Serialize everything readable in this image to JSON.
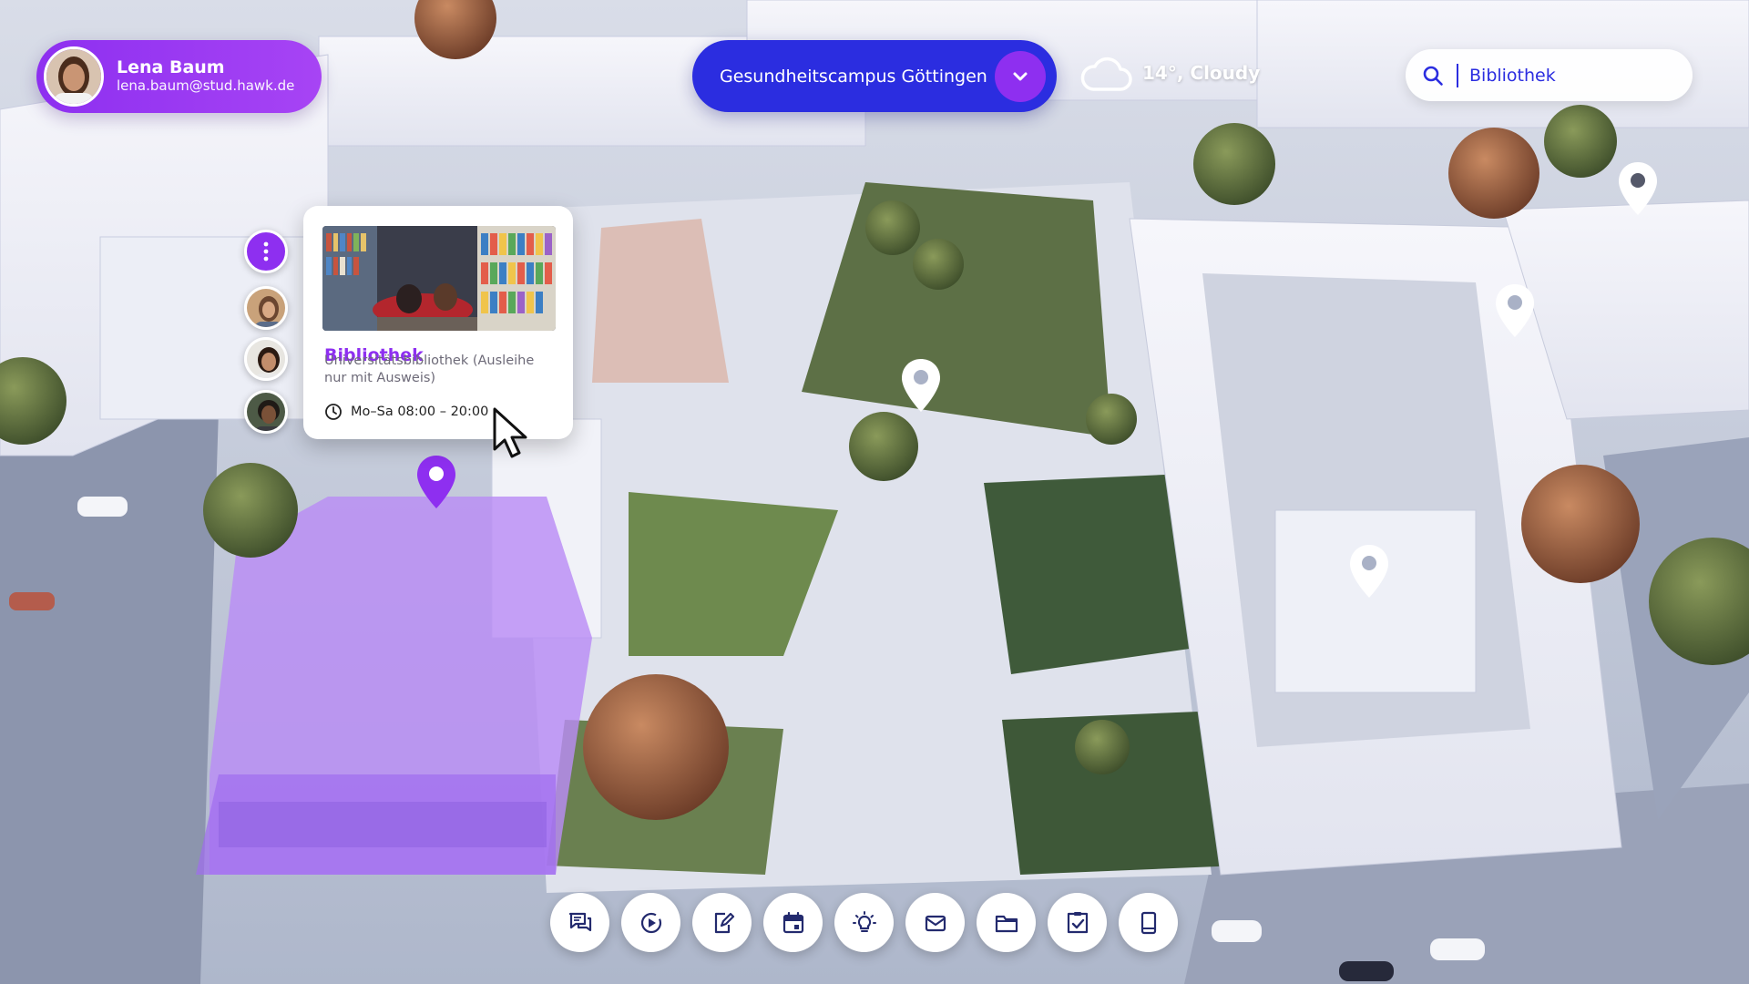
{
  "user": {
    "name": "Lena Baum",
    "email": "lena.baum@stud.hawk.de",
    "avatar_icon": "user-avatar"
  },
  "campus": {
    "name": "Gesundheitscampus Göttingen",
    "dropdown_icon": "chevron-down-icon"
  },
  "weather": {
    "text": "14°, Cloudy",
    "icon": "cloud-icon"
  },
  "search": {
    "value": "Bibliothek",
    "icon": "search-icon"
  },
  "contacts": {
    "menu_icon": "more-vertical-icon",
    "avatars": [
      "contact-1",
      "contact-2",
      "contact-3"
    ]
  },
  "info_card": {
    "title": "Bibliothek",
    "description": "Universitätsbibliothek (Ausleihe nur mit Ausweis)",
    "hours": "Mo–Sa 08:00 – 20:00",
    "hours_icon": "clock-icon"
  },
  "dock": [
    {
      "icon": "chat-icon"
    },
    {
      "icon": "play-circle-icon"
    },
    {
      "icon": "edit-document-icon"
    },
    {
      "icon": "calendar-icon"
    },
    {
      "icon": "lightbulb-icon"
    },
    {
      "icon": "mail-icon"
    },
    {
      "icon": "folder-icon"
    },
    {
      "icon": "checklist-icon"
    },
    {
      "icon": "tablet-icon"
    }
  ],
  "colors": {
    "purple": "#8e2ff0",
    "blue": "#2b2de0",
    "highlight": "#b98cf5"
  }
}
